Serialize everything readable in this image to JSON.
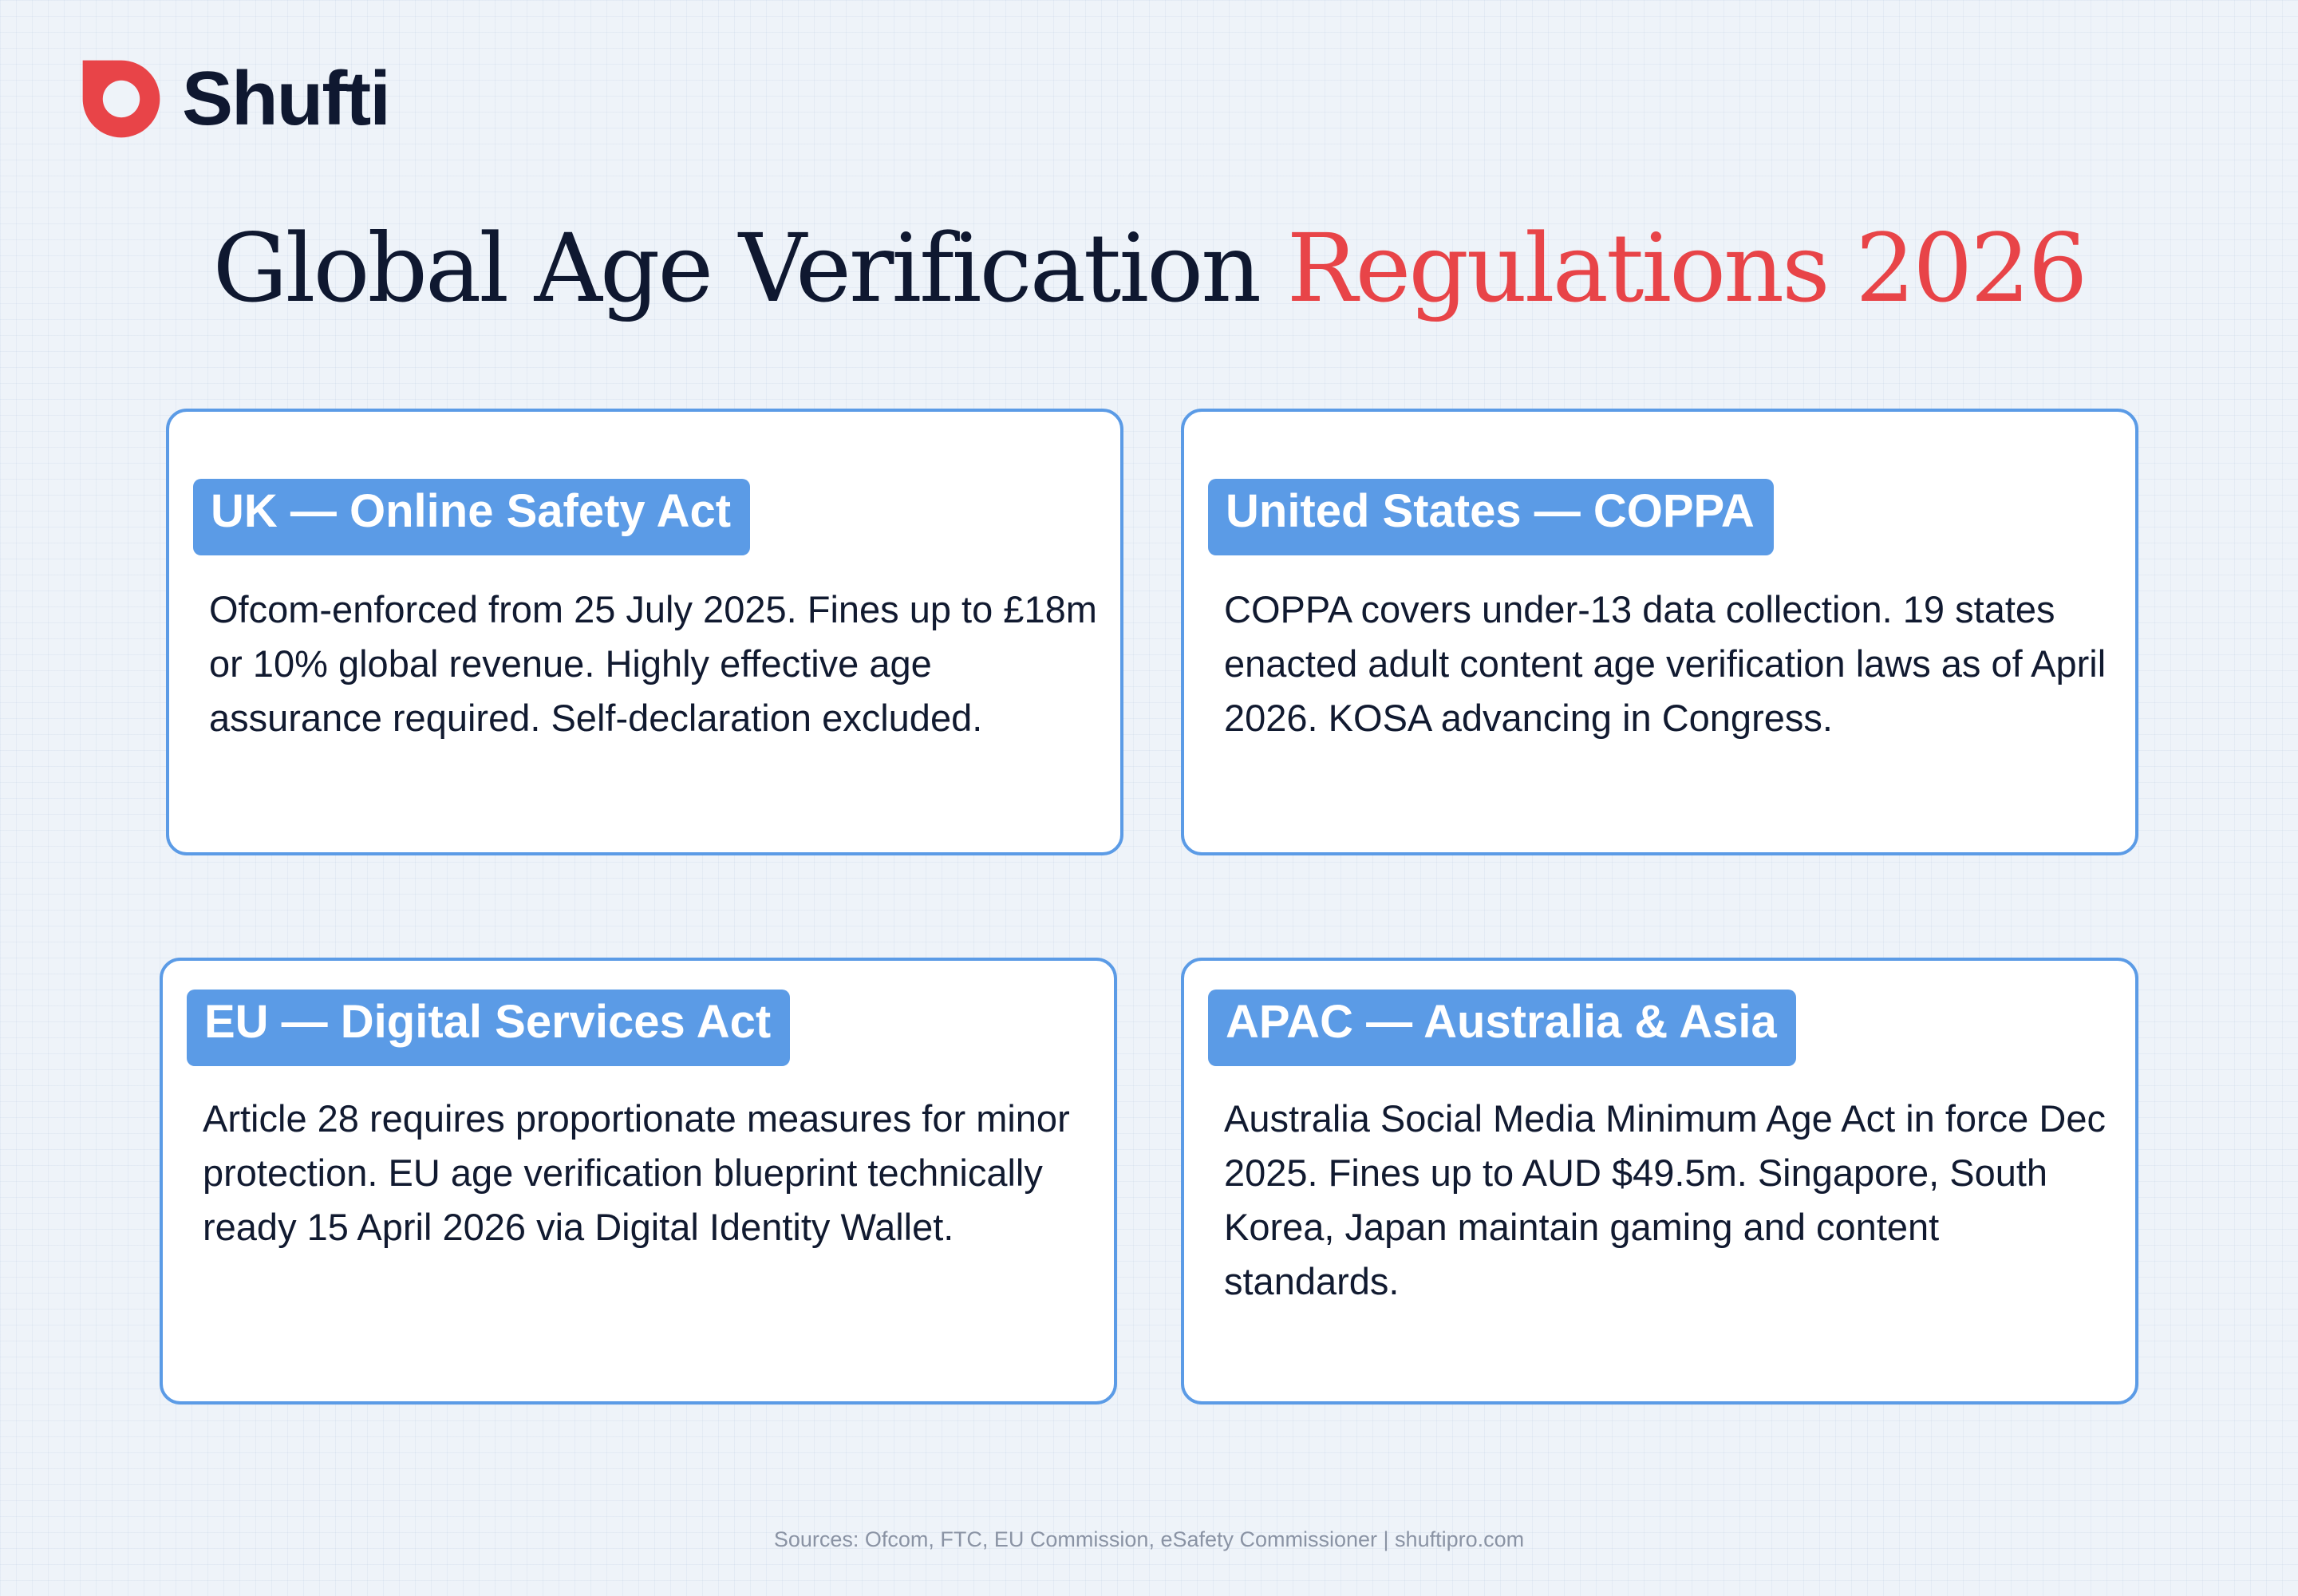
{
  "brand": {
    "name": "Shufti",
    "logo_icon": "shufti-ring-icon",
    "colors": {
      "accent": "#e84448",
      "dark": "#0f1830",
      "card_border": "#5b9be6",
      "badge_bg": "#5b9be6",
      "badge_text": "#ffffff",
      "background": "#eef3f9"
    }
  },
  "title": {
    "part1": "Global Age Verification",
    "part2": "Regulations 2026"
  },
  "cards": {
    "uk": {
      "heading": "UK — Online Safety Act",
      "body": "Ofcom-enforced from 25 July 2025. Fines up to £18m or 10% global revenue. Highly effective age assurance required. Self-declaration excluded."
    },
    "us": {
      "heading": "United States — COPPA",
      "body": "COPPA covers under-13 data collection. 19 states enacted adult content age verification laws as of April 2026. KOSA advancing in Congress."
    },
    "eu": {
      "heading": "EU — Digital Services Act",
      "body": "Article 28 requires proportionate measures for minor protection. EU age verification blueprint technically ready 15 April 2026 via Digital Identity Wallet."
    },
    "apac": {
      "heading": "APAC — Australia & Asia",
      "body": "Australia Social Media Minimum Age Act in force Dec 2025. Fines up to AUD $49.5m. Singapore, South Korea, Japan maintain gaming and content standards."
    }
  },
  "footer": {
    "sources": "Sources: Ofcom, FTC, EU Commission, eSafety Commissioner | shuftipro.com"
  }
}
